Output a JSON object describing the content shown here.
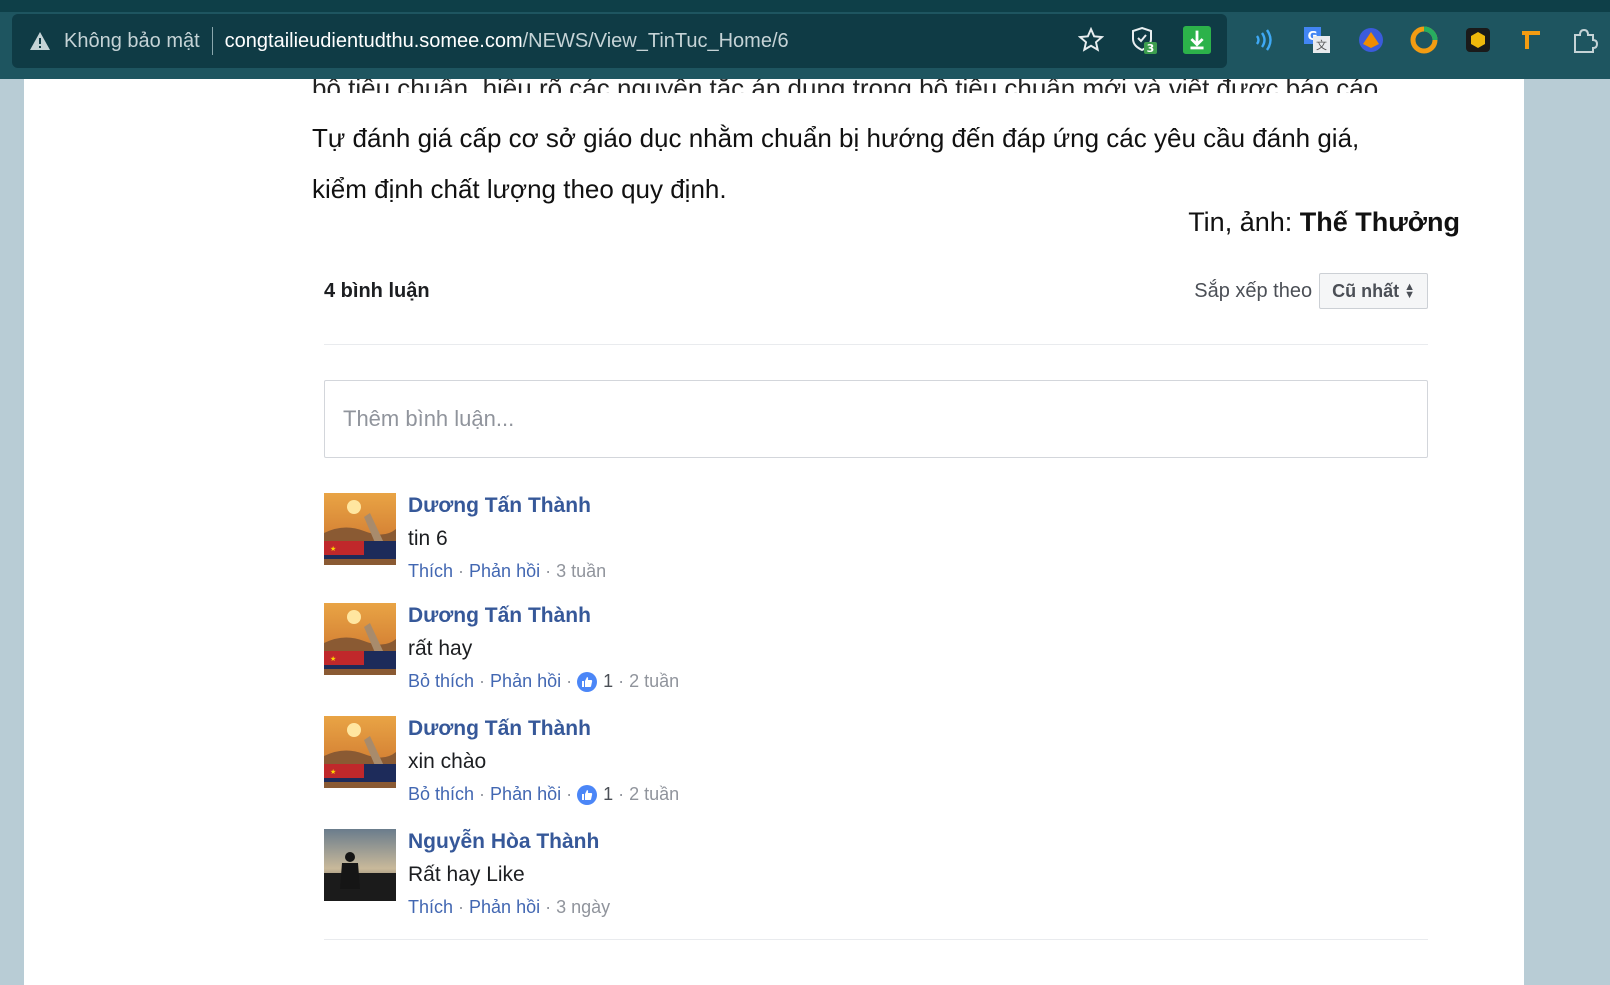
{
  "browser": {
    "security_text": "Không bảo mật",
    "url_domain": "congtailieudientudthu.somee.com",
    "url_path": "/NEWS/View_TinTuc_Home/6",
    "extension_badge": "3"
  },
  "article": {
    "cut_line": "bộ tiêu chuẩn, hiểu rõ các nguyên tắc áp dụng trong bộ tiêu chuẩn mới và viết được báo cáo",
    "line2": "Tự đánh giá cấp cơ sở giáo dục nhằm chuẩn bị hướng đến đáp ứng các yêu cầu đánh giá,",
    "line3": "kiểm định chất lượng theo quy định.",
    "byline_label": "Tin, ảnh:",
    "byline_author": "Thế Thưởng"
  },
  "comments": {
    "count_label": "4 bình luận",
    "sort_label": "Sắp xếp theo",
    "sort_value": "Cũ nhất",
    "placeholder": "Thêm bình luận...",
    "items": [
      {
        "name": "Dương Tấn Thành",
        "text": "tin 6",
        "like_label": "Thích",
        "reply_label": "Phản hồi",
        "likes": "",
        "time": "3 tuần"
      },
      {
        "name": "Dương Tấn Thành",
        "text": "rất hay",
        "like_label": "Bỏ thích",
        "reply_label": "Phản hồi",
        "likes": "1",
        "time": "2 tuần"
      },
      {
        "name": "Dương Tấn Thành",
        "text": "xin chào",
        "like_label": "Bỏ thích",
        "reply_label": "Phản hồi",
        "likes": "1",
        "time": "2 tuần"
      },
      {
        "name": "Nguyễn Hòa Thành",
        "text": "Rất hay Like",
        "like_label": "Thích",
        "reply_label": "Phản hồi",
        "likes": "",
        "time": "3 ngày"
      }
    ]
  },
  "colors": {
    "link": "#4267b2",
    "name": "#365899",
    "topbar": "#1e5560"
  }
}
